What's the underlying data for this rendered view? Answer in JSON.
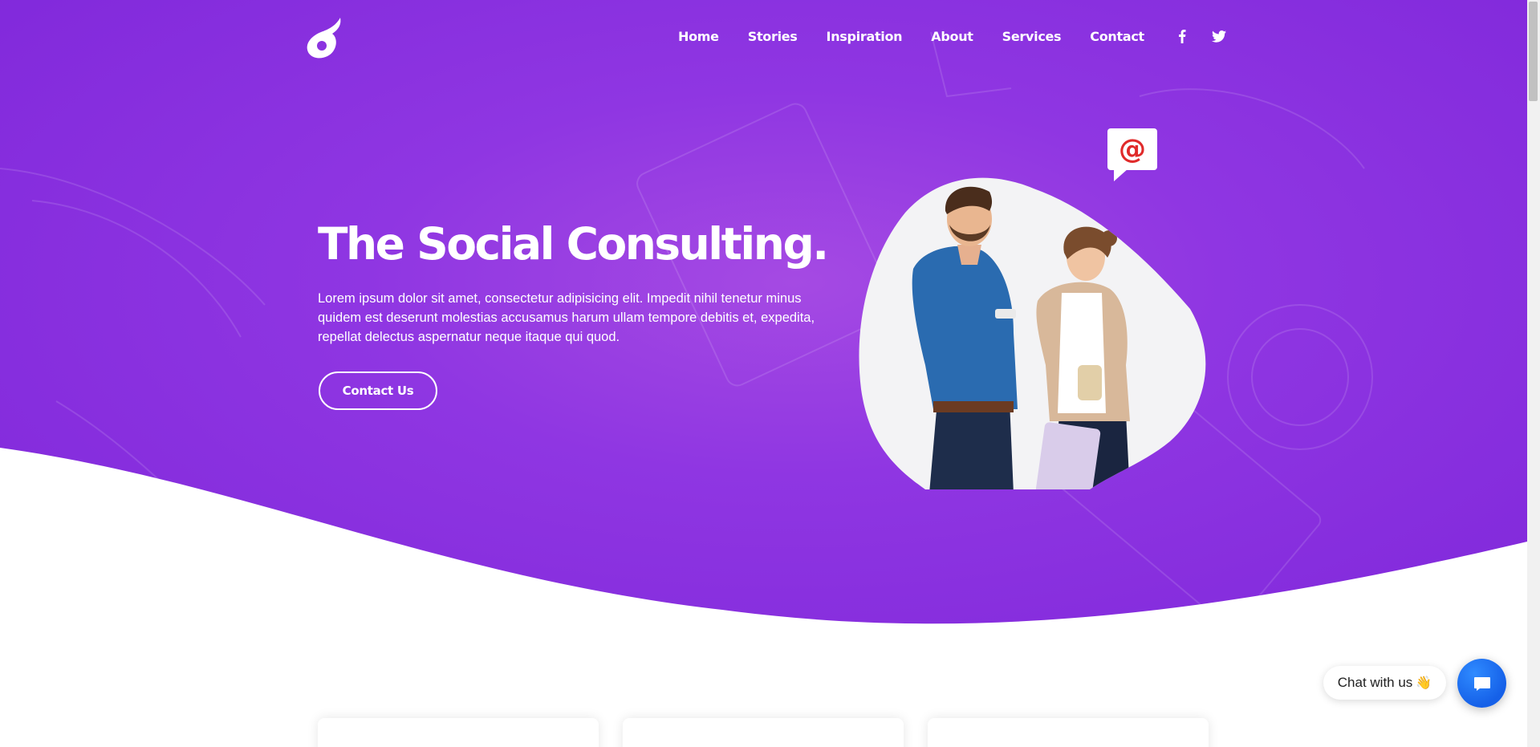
{
  "brand": {
    "logo_icon": "flame-drop-logo",
    "accent": "#8b2fe0",
    "wave_end": "#ffffff"
  },
  "nav": {
    "items": [
      {
        "label": "Home"
      },
      {
        "label": "Stories"
      },
      {
        "label": "Inspiration"
      },
      {
        "label": "About"
      },
      {
        "label": "Services"
      },
      {
        "label": "Contact"
      }
    ],
    "social": [
      {
        "icon": "facebook-icon"
      },
      {
        "icon": "twitter-icon"
      }
    ]
  },
  "hero": {
    "title": "The Social Consulting.",
    "description": "Lorem ipsum dolor sit amet, consectetur adipisicing elit. Impedit nihil tenetur minus quidem est deserunt molestias accusamus harum ullam tempore debitis et, expedita, repellat delectus aspernatur neque itaque qui quod.",
    "cta_label": "Contact Us",
    "illustration_icon": "two-people-illustration",
    "bubble_text": "@"
  },
  "chat": {
    "label": "Chat with us",
    "emoji": "👋",
    "button_icon": "chat-bubble-icon",
    "button_color": "#1e6ff5"
  },
  "cards": [
    {
      "name": "card-1"
    },
    {
      "name": "card-2"
    },
    {
      "name": "card-3"
    }
  ]
}
